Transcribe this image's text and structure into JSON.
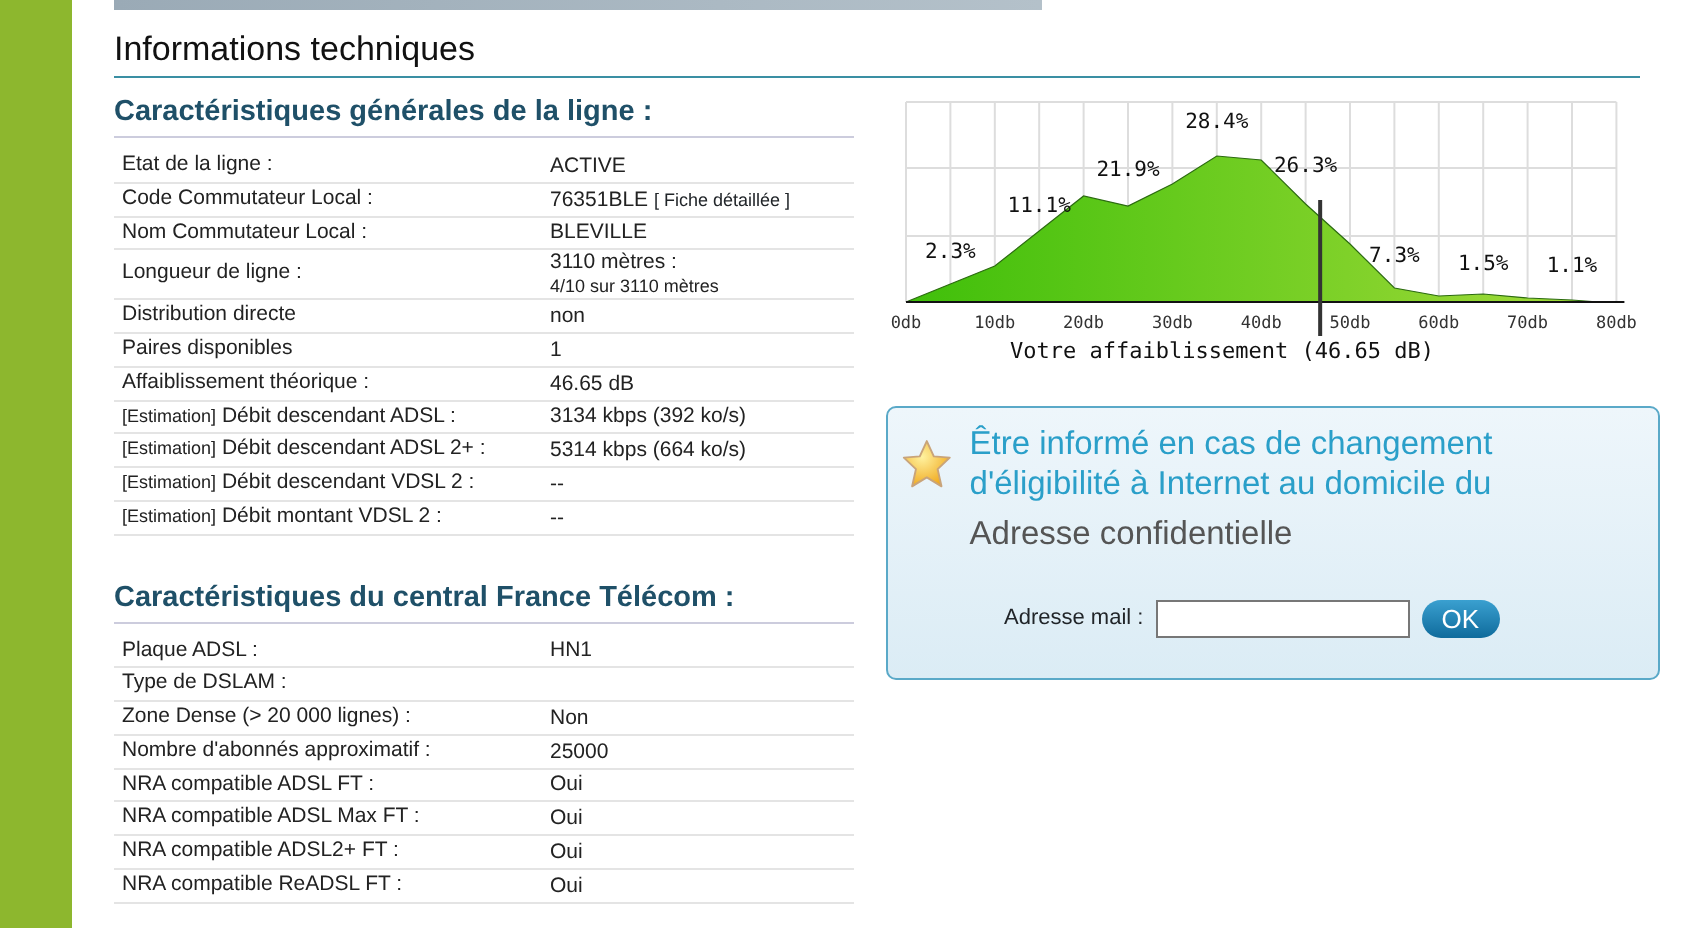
{
  "page_title": "Informations techniques",
  "line_section": {
    "title": "Caractéristiques générales de la ligne :",
    "rows": [
      {
        "label": "Etat de la ligne :",
        "value": "ACTIVE"
      },
      {
        "label": "Code Commutateur Local :",
        "value": "76351BLE",
        "link": "[ Fiche détaillée ]"
      },
      {
        "label": "Nom Commutateur Local :",
        "value": "BLEVILLE"
      },
      {
        "label": "Longueur de ligne :",
        "value": "3110 mètres :",
        "note": "4/10 sur 3110 mètres"
      },
      {
        "label": "Distribution directe",
        "value": "non"
      },
      {
        "label": "Paires disponibles",
        "value": "1"
      },
      {
        "label": "Affaiblissement théorique :",
        "value": "46.65 dB"
      },
      {
        "prefix": "[Estimation]",
        "label": "Débit descendant ADSL :",
        "value": "3134 kbps (392 ko/s)"
      },
      {
        "prefix": "[Estimation]",
        "label": "Débit descendant ADSL 2+ :",
        "value": "5314 kbps (664 ko/s)"
      },
      {
        "prefix": "[Estimation]",
        "label": "Débit descendant VDSL 2 :",
        "value": "--"
      },
      {
        "prefix": "[Estimation]",
        "label": "Débit montant VDSL 2 :",
        "value": "--"
      }
    ]
  },
  "central_section": {
    "title": "Caractéristiques du central France Télécom :",
    "rows": [
      {
        "label": "Plaque ADSL :",
        "value": "HN1"
      },
      {
        "label": "Type de DSLAM :"
      },
      {
        "label": "Zone Dense (> 20 000 lignes) :",
        "value": "Non"
      },
      {
        "label": "Nombre d'abonnés approximatif :",
        "value": "25000"
      },
      {
        "label": "NRA compatible ADSL FT :",
        "value": "Oui"
      },
      {
        "label": "NRA compatible ADSL Max FT :",
        "value": "Oui"
      },
      {
        "label": "NRA compatible ADSL2+ FT :",
        "value": "Oui"
      },
      {
        "label": "NRA compatible ReADSL FT :",
        "value": "Oui"
      }
    ]
  },
  "attenuation_chart": {
    "xticks": [
      "0db",
      "10db",
      "20db",
      "30db",
      "40db",
      "50db",
      "60db",
      "70db",
      "80db"
    ],
    "percent_labels": [
      "2.3%",
      "11.1%",
      "21.9%",
      "28.4%",
      "26.3%",
      "7.3%",
      "1.5%",
      "1.1%"
    ],
    "marker": {
      "label": "Votre affaiblissement (46.65 dB)",
      "level": 0.583
    }
  },
  "alert_box": {
    "title": "Être informé en cas de changement d'éligibilité à Internet au domicile du",
    "address": "Adresse confidentielle",
    "email_label": "Adresse mail :",
    "button": "OK"
  }
}
